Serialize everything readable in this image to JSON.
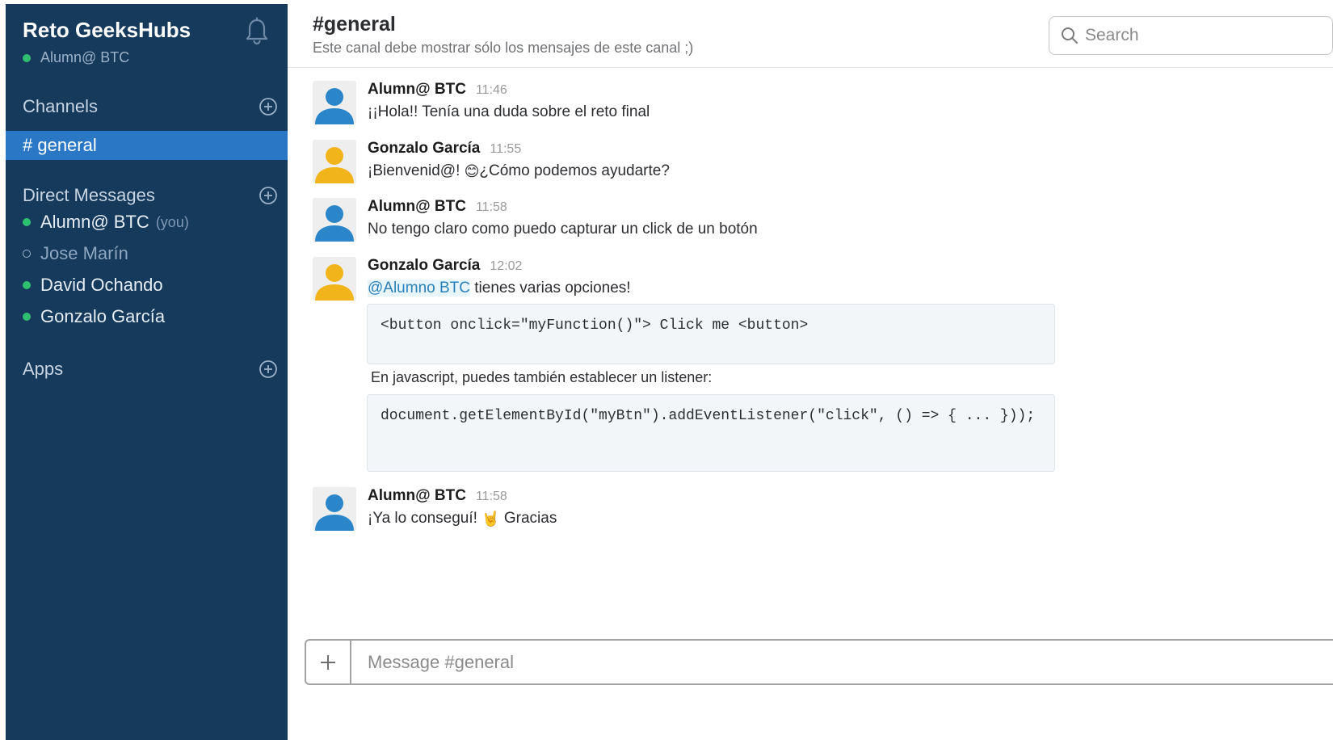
{
  "sidebar": {
    "team_name": "Reto GeeksHubs",
    "current_user": "Alumn@ BTC",
    "channels_header": "Channels",
    "active_channel": "# general",
    "dm_header": "Direct Messages",
    "direct_messages": [
      {
        "name": "Alumn@ BTC",
        "suffix": "(you)",
        "status": "online"
      },
      {
        "name": "Jose Marín",
        "suffix": "",
        "status": "offline"
      },
      {
        "name": "David Ochando",
        "suffix": "",
        "status": "online"
      },
      {
        "name": "Gonzalo García",
        "suffix": "",
        "status": "online"
      }
    ],
    "apps_header": "Apps"
  },
  "header": {
    "title": "#general",
    "topic": "Este canal debe mostrar sólo los mensajes de este canal ;)",
    "search_placeholder": "Search"
  },
  "messages": [
    {
      "author": "Alumn@ BTC",
      "time": "11:46",
      "text": "¡¡Hola!! Tenía una duda sobre el reto final",
      "avatar_color": "#2a86c9"
    },
    {
      "author": "Gonzalo García",
      "time": "11:55",
      "text_before": "¡Bienvenid@! ",
      "emoji": "😊",
      "text_after": "¿Cómo podemos ayudarte?",
      "avatar_color": "#f2b41b"
    },
    {
      "author": "Alumn@ BTC",
      "time": "11:58",
      "text": "No tengo claro como puedo capturar un click de un botón",
      "avatar_color": "#2a86c9"
    },
    {
      "author": "Gonzalo García",
      "time": "12:02",
      "mention": "@Alumno BTC",
      "text": " tienes varias opciones!",
      "code1": "<button onclick=\"myFunction()\"> Click me <button>",
      "middle_text": "En javascript, puedes también establecer un listener:",
      "code2": "document.getElementById(\"myBtn\").addEventListener(\"click\", () => { ... }));",
      "avatar_color": "#f2b41b"
    },
    {
      "author": "Alumn@ BTC",
      "time": "11:58",
      "text_before": "¡Ya lo conseguí! ",
      "emoji": "🤘",
      "text_after": " Gracias",
      "avatar_color": "#2a86c9"
    }
  ],
  "composer": {
    "placeholder": "Message #general"
  },
  "colors": {
    "sidebar_bg": "#163a5c",
    "active_channel_bg": "#2a78c5",
    "online": "#2fbf71",
    "mention": "#2a80b9"
  }
}
